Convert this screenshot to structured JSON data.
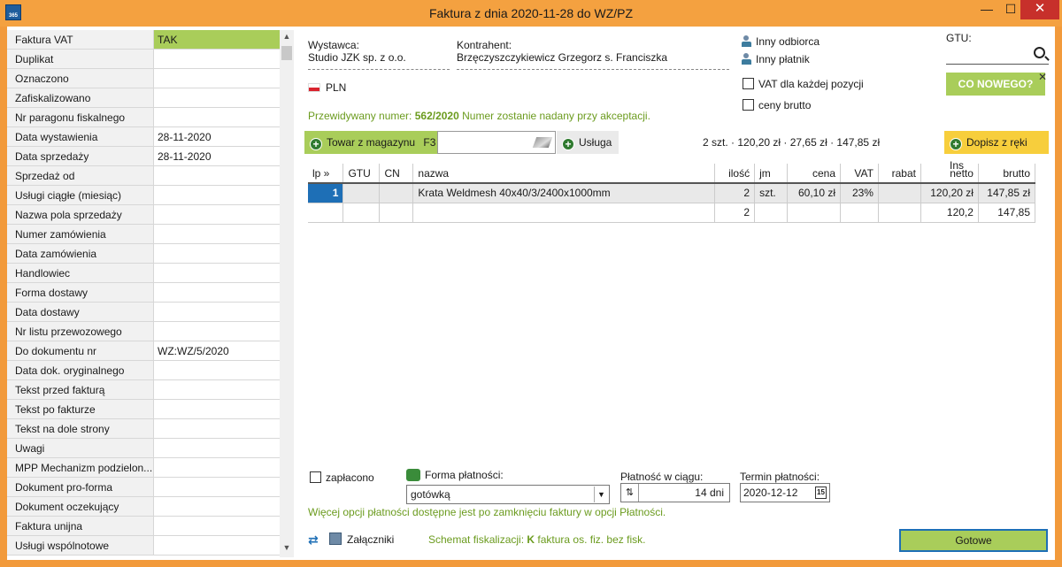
{
  "window": {
    "title": "Faktura z dnia 2020-11-28 do WZ/PZ",
    "app_icon_text": "365",
    "minimize": "—",
    "maximize": "☐",
    "close": "✕"
  },
  "props": [
    {
      "label": "Faktura VAT",
      "value": "TAK",
      "highlight": true
    },
    {
      "label": "Duplikat",
      "value": ""
    },
    {
      "label": "Oznaczono",
      "value": ""
    },
    {
      "label": "Zafiskalizowano",
      "value": ""
    },
    {
      "label": "Nr paragonu fiskalnego",
      "value": ""
    },
    {
      "label": "Data wystawienia",
      "value": "28-11-2020"
    },
    {
      "label": "Data sprzedaży",
      "value": "28-11-2020"
    },
    {
      "label": "Sprzedaż od",
      "value": ""
    },
    {
      "label": "Usługi ciągłe (miesiąc)",
      "value": ""
    },
    {
      "label": "Nazwa pola sprzedaży",
      "value": ""
    },
    {
      "label": "Numer zamówienia",
      "value": ""
    },
    {
      "label": "Data zamówienia",
      "value": ""
    },
    {
      "label": "Handlowiec",
      "value": ""
    },
    {
      "label": "Forma dostawy",
      "value": ""
    },
    {
      "label": "Data dostawy",
      "value": ""
    },
    {
      "label": "Nr listu przewozowego",
      "value": ""
    },
    {
      "label": "Do dokumentu nr",
      "value": "WZ:WZ/5/2020"
    },
    {
      "label": "Data dok. oryginalnego",
      "value": ""
    },
    {
      "label": "Tekst przed fakturą",
      "value": ""
    },
    {
      "label": "Tekst po fakturze",
      "value": ""
    },
    {
      "label": "Tekst na dole strony",
      "value": ""
    },
    {
      "label": "Uwagi",
      "value": ""
    },
    {
      "label": "MPP Mechanizm podzielon...",
      "value": ""
    },
    {
      "label": "Dokument pro-forma",
      "value": ""
    },
    {
      "label": "Dokument oczekujący",
      "value": ""
    },
    {
      "label": "Faktura unijna",
      "value": ""
    },
    {
      "label": "Usługi wspólnotowe",
      "value": ""
    }
  ],
  "header": {
    "wystawca_label": "Wystawca:",
    "wystawca_value": "Studio JZK sp. z o.o.",
    "kontrahent_label": "Kontrahent:",
    "kontrahent_value": "Brzęczyszczykiewicz Grzegorz s. Franciszka",
    "currency": "PLN",
    "inny_odbiorca": "Inny odbiorca",
    "inny_platnik": "Inny płatnik",
    "vat_per_item": "VAT dla każdej pozycji",
    "ceny_brutto": "ceny brutto",
    "gtu_label": "GTU:",
    "co_nowego": "CO NOWEGO?",
    "co_nowego_close": "✕",
    "przewidywany_prefix": "Przewidywany numer:",
    "przewidywany_number": "562/2020",
    "przewidywany_suffix": "Numer zostanie nadany przy akceptacji."
  },
  "toolbar": {
    "towar_label": "Towar z magazynu",
    "towar_shortcut": "F3",
    "usluga_label": "Usługa",
    "summary": "2 szt. · 120,20 zł · 27,65 zł · 147,85 zł",
    "dopisz_label": "Dopisz z ręki",
    "dopisz_shortcut": "Ins"
  },
  "table": {
    "headers": [
      "lp »",
      "GTU",
      "CN",
      "nazwa",
      "ilość",
      "jm",
      "cena",
      "VAT",
      "rabat",
      "netto",
      "brutto"
    ],
    "rows": [
      [
        "1",
        "",
        "",
        "Krata Weldmesh 40x40/3/2400x1000mm",
        "2",
        "szt.",
        "60,10 zł",
        "23%",
        "",
        "120,20 zł",
        "147,85 zł"
      ],
      [
        "",
        "",
        "",
        "",
        "2",
        "",
        "",
        "",
        "",
        "120,2",
        "147,85"
      ]
    ]
  },
  "footer": {
    "zaplacono": "zapłacono",
    "forma_label": "Forma płatności:",
    "forma_value": "gotówką",
    "platnosc_label": "Płatność w ciągu:",
    "platnosc_value": "14 dni",
    "termin_label": "Termin płatności:",
    "termin_value": "2020-12-12",
    "more_options": "Więcej opcji płatności dostępne jest po zamknięciu faktury w opcji Płatności.",
    "zalaczniki": "Załączniki",
    "schemat_prefix": "Schemat fiskalizacji:",
    "schemat_code": "K",
    "schemat_suffix": "faktura os. fiz. bez fisk.",
    "gotowe": "Gotowe"
  }
}
